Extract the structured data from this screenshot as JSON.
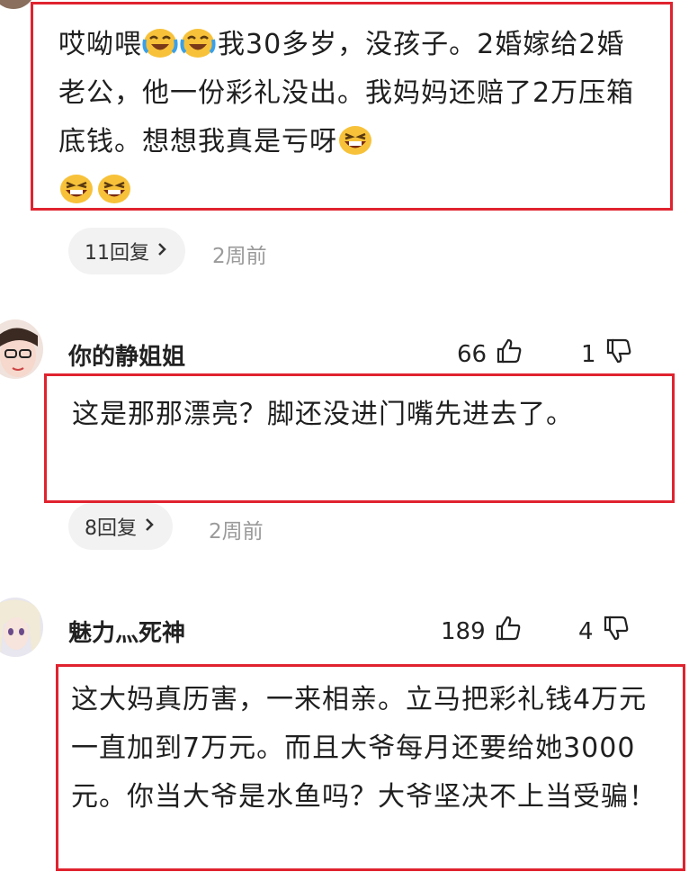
{
  "comments": [
    {
      "text_parts": [
        "哎呦喂",
        "我30多岁，没孩子。2婚嫁给2婚老公，他一份彩礼没出。我妈妈还赔了2万压箱底钱。想想我真是亏呀"
      ],
      "emojis": [
        "cry-laugh-emoji",
        "cry-laugh-emoji",
        "grin-emoji",
        "grin-emoji",
        "grin-emoji"
      ],
      "replies_label": "11回复",
      "time": "2周前"
    },
    {
      "username": "你的静姐姐",
      "likes": "66",
      "dislikes": "1",
      "text": "这是那那漂亮？脚还没进门嘴先进去了。",
      "replies_label": "8回复",
      "time": "2周前"
    },
    {
      "username": "魅力灬死神",
      "likes": "189",
      "dislikes": "4",
      "text": "这大妈真历害，一来相亲。立马把彩礼钱4万元一直加到7万元。而且大爷每月还要给她3000元。你当大爷是水鱼吗？大爷坚决不上当受骗！"
    }
  ],
  "colors": {
    "highlight_border": "#e0232f",
    "pill_bg": "#f2f2f2",
    "muted": "#9a9a9a"
  }
}
